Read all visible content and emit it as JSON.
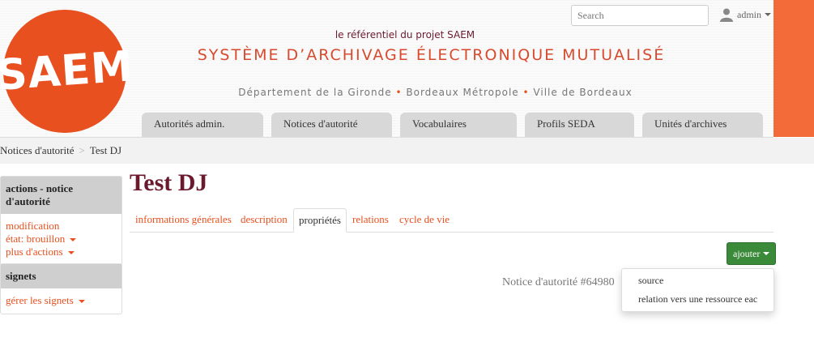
{
  "header": {
    "logo_text": "SAEM",
    "subtitle": "le référentiel du projet SAEM",
    "title": "SYSTÈME D’ARCHIVAGE ÉLECTRONIQUE MUTUALISÉ",
    "departments": [
      "Département de la Gironde",
      "Bordeaux Métropole",
      "Ville de Bordeaux"
    ],
    "search_placeholder": "Search",
    "user": "admin"
  },
  "nav": [
    "Autorités admin.",
    "Notices d'autorité",
    "Vocabulaires",
    "Profils SEDA",
    "Unités d'archives"
  ],
  "breadcrumb": [
    "Notices d'autorité",
    "Test DJ"
  ],
  "actions_panel": {
    "title": "actions - notice d'autorité",
    "items": [
      "modification",
      "état: brouillon",
      "plus d'actions"
    ]
  },
  "bookmarks_panel": {
    "title": "signets",
    "items": [
      "gérer les signets"
    ]
  },
  "page": {
    "title": "Test DJ"
  },
  "tabs": [
    {
      "label": "informations générales",
      "active": false
    },
    {
      "label": "description",
      "active": false
    },
    {
      "label": "propriétés",
      "active": true
    },
    {
      "label": "relations",
      "active": false
    },
    {
      "label": "cycle de vie",
      "active": false
    }
  ],
  "add_button": "ajouter",
  "notice_id": "Notice d'autorité #64980",
  "dropdown": [
    "source",
    "relation vers une ressource eac"
  ],
  "colors": {
    "accent": "#e8501f",
    "title": "#6b1a2e",
    "button": "#3a8a3a",
    "strip": "#f26b38"
  }
}
